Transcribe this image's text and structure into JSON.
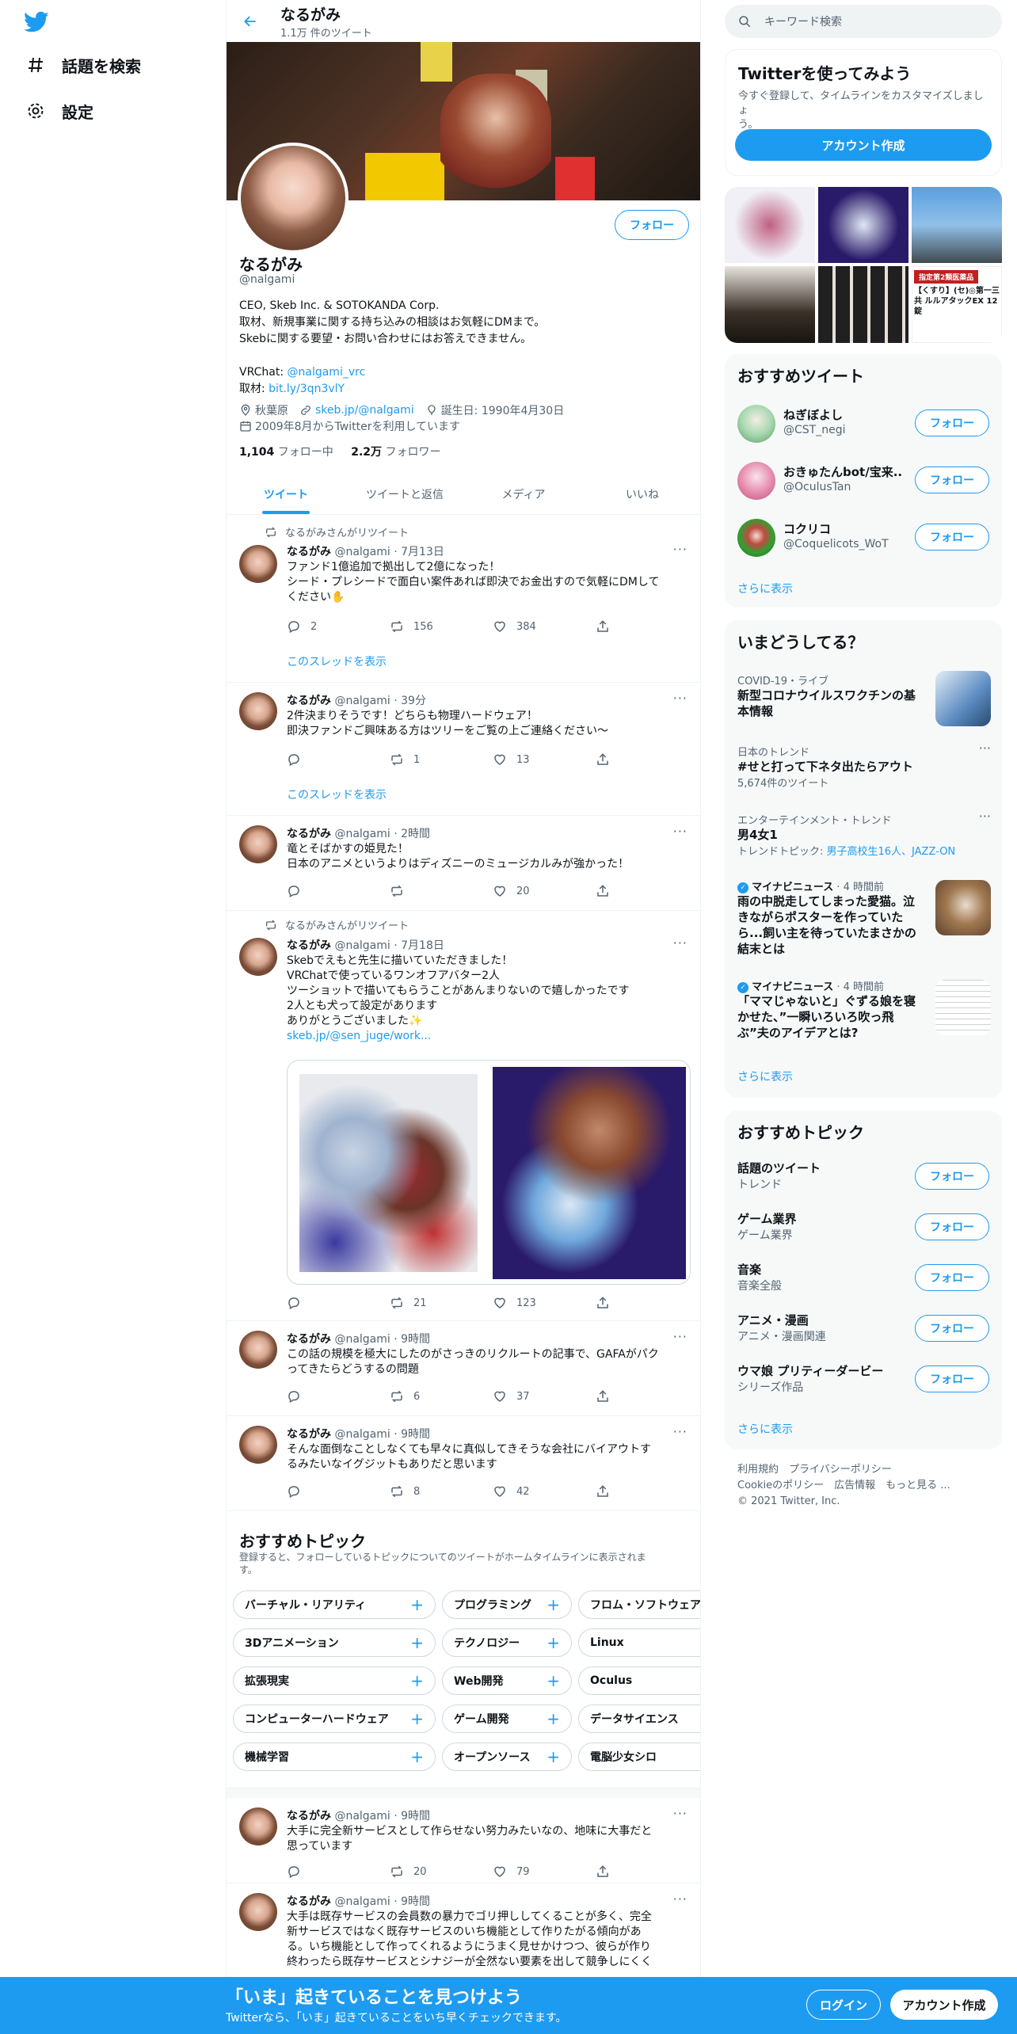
{
  "nav": {
    "explore": "話題を検索",
    "settings": "設定"
  },
  "header": {
    "name": "なるがみ",
    "tweet_count": "1.1万 件のツイート"
  },
  "profile": {
    "name": "なるがみ",
    "handle": "@nalgami",
    "follow": "フォロー",
    "bio_lines": [
      "CEO, Skeb Inc. & SOTOKANDA Corp.",
      "取材、新規事業に関する持ち込みの相談はお気軽にDMまで。",
      "Skebに関する要望・お問い合わせにはお答えできません。"
    ],
    "vrchat_label": "VRChat: ",
    "vrchat_link": "@nalgami_vrc",
    "interview_label": "取材: ",
    "interview_link": "bit.ly/3qn3vlY",
    "location": "秋葉原",
    "website": "skeb.jp/@nalgami",
    "birthday": "誕生日: 1990年4月30日",
    "joined": "2009年8月からTwitterを利用しています",
    "following_count": "1,104",
    "following_label": "フォロー中",
    "followers_count": "2.2万",
    "followers_label": "フォロワー"
  },
  "tabs": [
    "ツイート",
    "ツイートと返信",
    "メディア",
    "いいね"
  ],
  "tweets": [
    {
      "rt_label": "なるがみさんがリツイート",
      "name": "なるがみ",
      "handle": "@nalgami · 7月13日",
      "lines": [
        "ファンド1億追加で拠出して2億になった！",
        "シード・プレシードで面白い案件あれば即決でお金出すので気軽にDMして",
        "ください✋"
      ],
      "reply": "2",
      "retweet": "156",
      "like": "384",
      "thread": "このスレッドを表示"
    },
    {
      "name": "なるがみ",
      "handle": "@nalgami · 39分",
      "lines": [
        "2件決まりそうです！どちらも物理ハードウェア！",
        "即決ファンドご興味ある方はツリーをご覧の上ご連絡ください〜"
      ],
      "reply": "",
      "retweet": "1",
      "like": "13",
      "thread": "このスレッドを表示"
    },
    {
      "name": "なるがみ",
      "handle": "@nalgami · 2時間",
      "lines": [
        "竜とそばかすの姫見た！",
        "日本のアニメというよりはディズニーのミュージカルみが強かった！"
      ],
      "reply": "",
      "retweet": "",
      "like": "20"
    },
    {
      "rt_label": "なるがみさんがリツイート",
      "name": "なるがみ",
      "handle": "@nalgami · 7月18日",
      "lines": [
        "Skebでえもと先生に描いていただきました！",
        "VRChatで使っているワンオフアバター2人",
        "ツーショットで描いてもらうことがあんまりないので嬉しかったです",
        "2人とも犬って設定があります",
        "ありがとうございました✨"
      ],
      "link": "skeb.jp/@sen_juge/work...",
      "reply": "",
      "retweet": "21",
      "like": "123"
    },
    {
      "name": "なるがみ",
      "handle": "@nalgami · 9時間",
      "lines": [
        "この話の規模を極大にしたのがさっきのリクルートの記事で、GAFAがパク",
        "ってきたらどうするの問題"
      ],
      "reply": "",
      "retweet": "6",
      "like": "37"
    },
    {
      "name": "なるがみ",
      "handle": "@nalgami · 9時間",
      "lines": [
        "そんな面倒なことしなくても早々に真似してきそうな会社にバイアウトす",
        "るみたいなイグジットもありだと思います"
      ],
      "reply": "",
      "retweet": "8",
      "like": "42"
    },
    {
      "name": "なるがみ",
      "handle": "@nalgami · 9時間",
      "lines": [
        "大手に完全新サービスとして作らせない努力みたいなの、地味に大事だと",
        "思っています"
      ],
      "reply": "",
      "retweet": "20",
      "like": "79"
    },
    {
      "name": "なるがみ",
      "handle": "@nalgami · 9時間",
      "lines": [
        "大手は既存サービスの会員数の暴力でゴリ押ししてくることが多く、完全",
        "新サービスではなく既存サービスのいち機能として作りたがる傾向があ",
        "る。いち機能として作ってくれるようにうまく見せかけつつ、彼らが作り",
        "終わったら既存サービスとシナジーが全然ない要素を出して競争しにくく"
      ]
    }
  ],
  "topics_section": {
    "title": "おすすめトピック",
    "subtitle": "登録すると、フォローしているトピックについてのツイートがホームタイムラインに表示されま",
    "subtitle2": "す。",
    "rows": [
      [
        "バーチャル・リアリティ",
        "プログラミング",
        "フロム・ソフトウェア"
      ],
      [
        "3Dアニメーション",
        "テクノロジー",
        "Linux"
      ],
      [
        "拡張現実",
        "Web開発",
        "Oculus"
      ],
      [
        "コンピューターハードウェア",
        "ゲーム開発",
        "データサイエンス"
      ],
      [
        "機械学習",
        "オープンソース",
        "電脳少女シロ"
      ]
    ]
  },
  "right": {
    "search_placeholder": "キーワード検索",
    "signup_title": "Twitterを使ってみよう",
    "signup_text1": "今すぐ登録して、タイムラインをカスタマイズしましょ",
    "signup_text2": "う。",
    "signup_button": "アカウント作成",
    "ad_caption": "【くすり】(セ)◎第一三共 ルルアタックEX 12錠",
    "ad_badge": "指定第2類医薬品",
    "recommended_title": "おすすめツイート",
    "recommended": [
      {
        "name": "ねぎぼよし",
        "handle": "@CST_negi"
      },
      {
        "name": "おきゅたんbot/宝来...",
        "handle": "@OculusTan"
      },
      {
        "name": "コクリコ",
        "handle": "@Coquelicots_WoT"
      }
    ],
    "show_more": "さらに表示",
    "trends_title": "いまどうしてる？",
    "trends": [
      {
        "context": "COVID-19・ライブ",
        "title1": "新型コロナウイルスワクチンの基",
        "title2": "本情報"
      },
      {
        "context": "日本のトレンド",
        "title1": "#せと打って下ネタ出たらアウト",
        "count": "5,674件のツイート"
      },
      {
        "context": "エンターテインメント・トレンド",
        "title1": "男4女1",
        "topic_prefix": "トレンドトピック: ",
        "topic_links": "男子高校生16人、JAZZ-ON"
      },
      {
        "context": "マイナビニュース",
        "time": "· 4 時間前",
        "title1": "雨の中脱走してしまった愛猫。泣",
        "title2": "きながらポスターを作っていた",
        "title3": "ら...飼い主を待っていたまさかの",
        "title4": "結末とは"
      },
      {
        "context": "マイナビニュース",
        "time": "· 4 時間前",
        "title1": "「ママじゃないと」ぐずる娘を寝",
        "title2": "かせた、”一瞬いろいろ吹っ飛",
        "title3": "ぶ”夫のアイデアとは?"
      }
    ],
    "topics_title": "おすすめトピック",
    "topics": [
      {
        "name": "話題のツイート",
        "cat": "トレンド"
      },
      {
        "name": "ゲーム業界",
        "cat": "ゲーム業界"
      },
      {
        "name": "音楽",
        "cat": "音楽全般"
      },
      {
        "name": "アニメ・漫画",
        "cat": "アニメ・漫画関連"
      },
      {
        "name": "ウマ娘 プリティーダービー",
        "cat": "シリーズ作品"
      }
    ],
    "footer1": "利用規約　プライバシーポリシー",
    "footer2": "Cookieのポリシー　広告情報　もっと見る ...",
    "footer3": "© 2021 Twitter, Inc."
  },
  "bottom": {
    "title": "「いま」起きていることを見つけよう",
    "subtitle": "Twitterなら、「いま」起きていることをいち早くチェックできます。",
    "login": "ログイン",
    "signup": "アカウント作成"
  },
  "colors": {
    "accent": "#1d9bf0",
    "text": "#0f1419",
    "muted": "#536471"
  }
}
